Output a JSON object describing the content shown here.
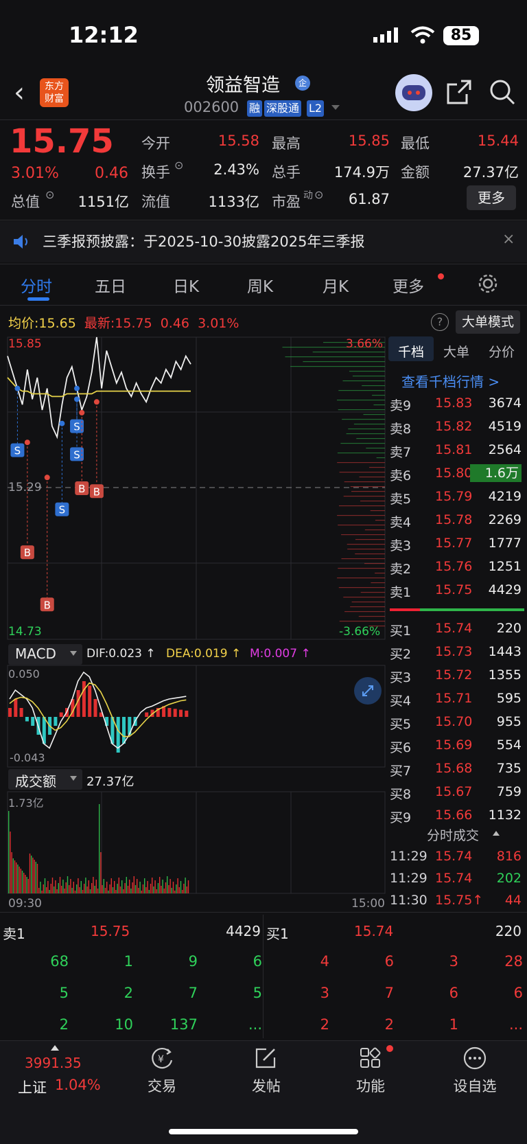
{
  "status": {
    "time": "12:12",
    "battery": "85"
  },
  "header": {
    "logo": "东方\n财富",
    "name": "领益智造",
    "qi_badge": "企",
    "code": "002600",
    "tags": [
      "融",
      "深股通",
      "L2"
    ]
  },
  "quote": {
    "price": "15.75",
    "change_pct": "3.01%",
    "change": "0.46",
    "open_label": "今开",
    "open": "15.58",
    "high_label": "最高",
    "high": "15.85",
    "low_label": "最低",
    "low": "15.44",
    "turnover_label": "换手",
    "turnover": "2.43%",
    "volume_label": "总手",
    "volume": "174.9万",
    "amount_label": "金额",
    "amount": "27.37亿",
    "mcap_label": "总值",
    "mcap": "1151亿",
    "float_label": "流值",
    "float_cap": "1133亿",
    "pe_label": "市盈",
    "pe_sup": "动",
    "pe": "61.87",
    "more": "更多"
  },
  "notice": {
    "text": "三季报预披露：于2025-10-30披露2025年三季报",
    "close": "×"
  },
  "tabs": [
    "分时",
    "五日",
    "日K",
    "周K",
    "月K",
    "更多"
  ],
  "chart": {
    "avg_label": "均价:",
    "avg": "15.65",
    "latest_label": "最新:",
    "latest": "15.75",
    "latest_change": "0.46",
    "latest_pct": "3.01%",
    "big_order_mode": "大单模式",
    "y_high": "15.85",
    "y_prev_close": "15.29",
    "y_low": "14.73",
    "pct_high": "3.66%",
    "pct_low": "-3.66%",
    "macd_label": "MACD",
    "dif": "DIF:0.023 ↑",
    "dea": "DEA:0.019 ↑",
    "m": "M:0.007 ↑",
    "macd_top": "0.050",
    "macd_bottom": "-0.043",
    "vol_label": "成交额",
    "vol_total": "27.37亿",
    "vol_max": "1.73亿",
    "time_start": "09:30",
    "time_end": "15:00",
    "trade_markers": {
      "b": "B",
      "s": "S"
    }
  },
  "chart_data": {
    "type": "line",
    "x_range": [
      "09:30",
      "15:00"
    ],
    "ylim": [
      14.73,
      15.85
    ],
    "prev_close": 15.29,
    "series": [
      {
        "name": "最新",
        "values": [
          15.78,
          15.72,
          15.66,
          15.6,
          15.73,
          15.62,
          15.7,
          15.58,
          15.66,
          15.52,
          15.48,
          15.6,
          15.7,
          15.74,
          15.66,
          15.58,
          15.63,
          15.72,
          15.85,
          15.66,
          15.8,
          15.74,
          15.68,
          15.72,
          15.66,
          15.63,
          15.68,
          15.64,
          15.61,
          15.66,
          15.7,
          15.68,
          15.73,
          15.7,
          15.76,
          15.73,
          15.78,
          15.75
        ]
      },
      {
        "name": "均价",
        "values": [
          15.7,
          15.68,
          15.66,
          15.65,
          15.65,
          15.64,
          15.64,
          15.64,
          15.64,
          15.63,
          15.63,
          15.63,
          15.64,
          15.64,
          15.64,
          15.64,
          15.64,
          15.64,
          15.65,
          15.65,
          15.65,
          15.65,
          15.65,
          15.65,
          15.65,
          15.65,
          15.65,
          15.65,
          15.65,
          15.65,
          15.65,
          15.65,
          15.65,
          15.65,
          15.65,
          15.65,
          15.65,
          15.65
        ]
      }
    ]
  },
  "orderbook": {
    "tabs": [
      "千档",
      "大单",
      "分价"
    ],
    "link": "查看千档行情 >",
    "asks": [
      {
        "label": "卖9",
        "price": "15.83",
        "vol": "3674"
      },
      {
        "label": "卖8",
        "price": "15.82",
        "vol": "4519"
      },
      {
        "label": "卖7",
        "price": "15.81",
        "vol": "2564"
      },
      {
        "label": "卖6",
        "price": "15.80",
        "vol": "1.6万"
      },
      {
        "label": "卖5",
        "price": "15.79",
        "vol": "4219"
      },
      {
        "label": "卖4",
        "price": "15.78",
        "vol": "2269"
      },
      {
        "label": "卖3",
        "price": "15.77",
        "vol": "1777"
      },
      {
        "label": "卖2",
        "price": "15.76",
        "vol": "1251"
      },
      {
        "label": "卖1",
        "price": "15.75",
        "vol": "4429"
      }
    ],
    "bids": [
      {
        "label": "买1",
        "price": "15.74",
        "vol": "220"
      },
      {
        "label": "买2",
        "price": "15.73",
        "vol": "1443"
      },
      {
        "label": "买3",
        "price": "15.72",
        "vol": "1355"
      },
      {
        "label": "买4",
        "price": "15.71",
        "vol": "595"
      },
      {
        "label": "买5",
        "price": "15.70",
        "vol": "955"
      },
      {
        "label": "买6",
        "price": "15.69",
        "vol": "554"
      },
      {
        "label": "买7",
        "price": "15.68",
        "vol": "735"
      },
      {
        "label": "买8",
        "price": "15.67",
        "vol": "759"
      },
      {
        "label": "买9",
        "price": "15.66",
        "vol": "1132"
      }
    ],
    "ticks_title": "分时成交",
    "ticks": [
      {
        "time": "11:29",
        "price": "15.74",
        "vol": "816"
      },
      {
        "time": "11:29",
        "price": "15.74",
        "vol": "202"
      },
      {
        "time": "11:30",
        "price": "15.75↑",
        "vol": "44"
      }
    ]
  },
  "queue": {
    "ask_label": "卖1",
    "ask_price": "15.75",
    "ask_vol": "4429",
    "bid_label": "买1",
    "bid_price": "15.74",
    "bid_vol": "220",
    "ask_rows": [
      [
        "68",
        "1",
        "9",
        "6"
      ],
      [
        "5",
        "2",
        "7",
        "5"
      ],
      [
        "2",
        "10",
        "137",
        "..."
      ]
    ],
    "bid_rows": [
      [
        "4",
        "6",
        "3",
        "28"
      ],
      [
        "3",
        "7",
        "6",
        "6"
      ],
      [
        "2",
        "2",
        "1",
        "..."
      ]
    ]
  },
  "nav": {
    "index_value": "3991.35",
    "index_name": "上证",
    "index_pct": "1.04%",
    "items": [
      "交易",
      "发帖",
      "功能",
      "设自选"
    ]
  }
}
